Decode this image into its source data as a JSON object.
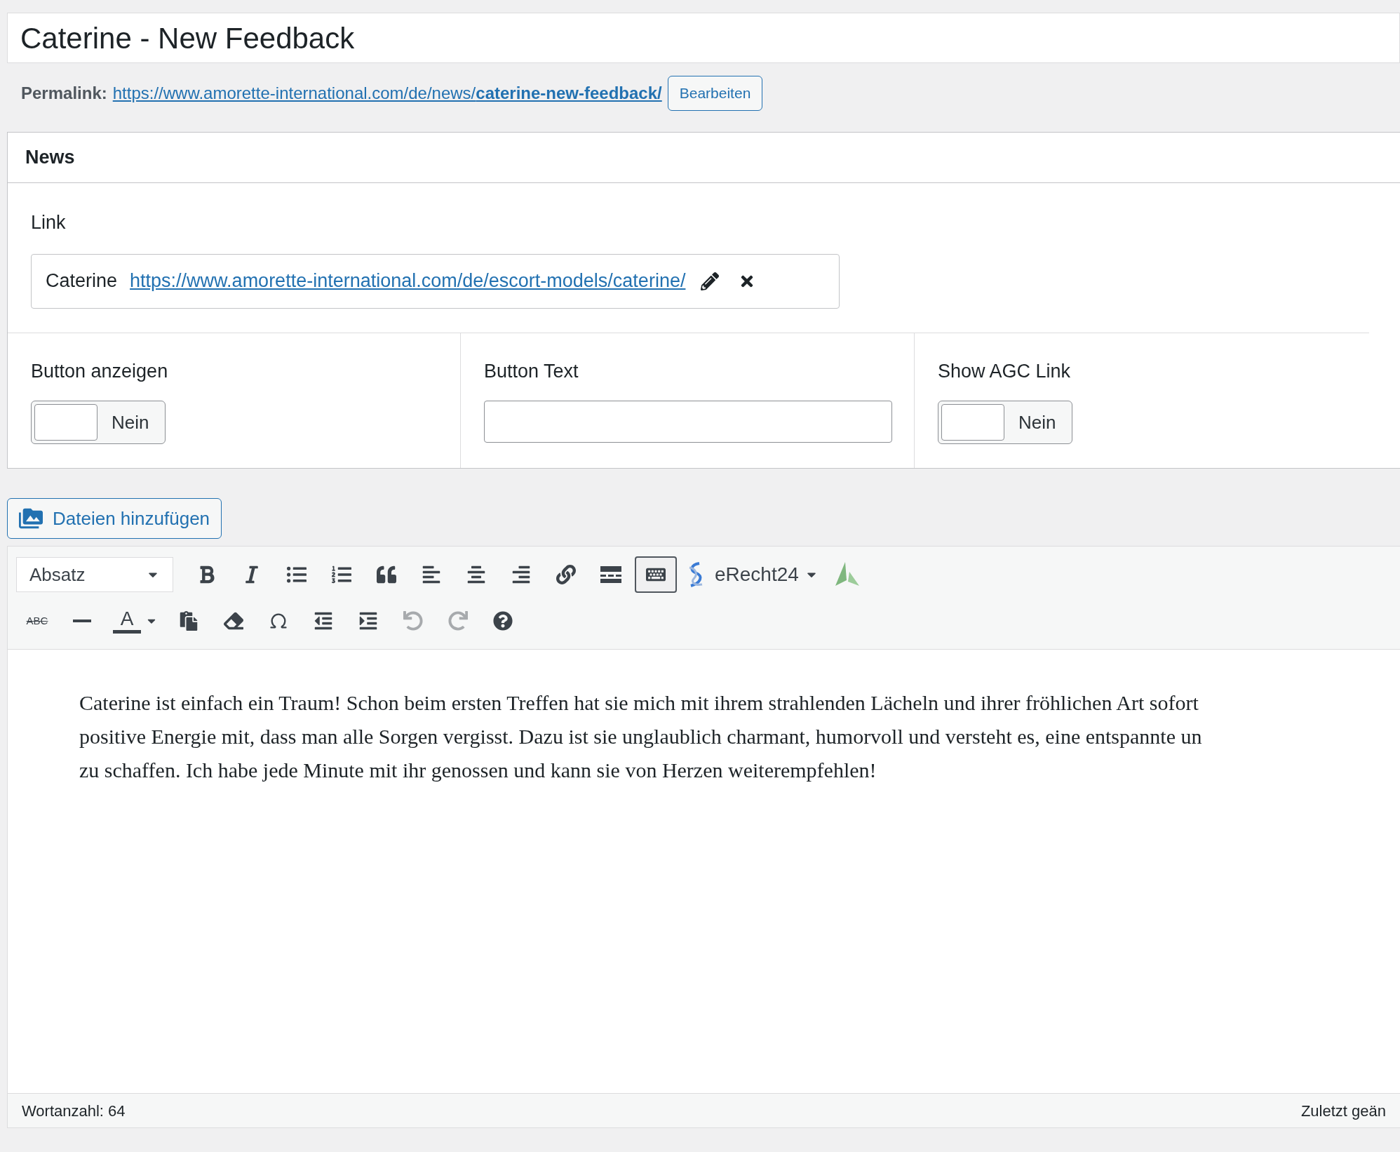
{
  "title": {
    "value": "Caterine - New Feedback"
  },
  "permalink": {
    "label": "Permalink:",
    "url": "https://www.amorette-international.com/de/news/**caterine-new-feedback/**",
    "button": "Bearbeiten"
  },
  "news_box": {
    "title": "News",
    "link_label": "Link",
    "link": {
      "text": "Caterine",
      "url": "https://www.amorette-international.com/de/escort-models/caterine/"
    },
    "fields": [
      {
        "kind": "toggle",
        "label": "Button anzeigen",
        "on": false,
        "state_text": "Nein"
      },
      {
        "kind": "text",
        "label": "Button Text"
      },
      {
        "kind": "toggle",
        "label": "Show AGC Link",
        "on": false,
        "state_text": "Nein"
      }
    ]
  },
  "media_button": "Dateien hinzufügen",
  "toolbar": {
    "rows": [
      [
        {
          "kind": "format",
          "label": "Absatz"
        },
        {
          "kind": "bold"
        },
        {
          "kind": "italic"
        },
        {
          "kind": "bullets"
        },
        {
          "kind": "numbers"
        },
        {
          "kind": "quote"
        },
        {
          "kind": "alignleft"
        },
        {
          "kind": "aligncenter"
        },
        {
          "kind": "alignright"
        },
        {
          "kind": "link"
        },
        {
          "kind": "more"
        },
        {
          "kind": "sink",
          "pressed": true
        },
        {
          "kind": "erecht",
          "label": "eRecht24"
        },
        {
          "kind": "leaf"
        }
      ],
      [
        {
          "kind": "strike",
          "label": "ABC"
        },
        {
          "kind": "hr"
        },
        {
          "kind": "color",
          "label": "A"
        },
        {
          "kind": "paste"
        },
        {
          "kind": "eraser"
        },
        {
          "kind": "omega"
        },
        {
          "kind": "outdent"
        },
        {
          "kind": "indent"
        },
        {
          "kind": "undo",
          "disabled": true
        },
        {
          "kind": "redo",
          "disabled": true
        },
        {
          "kind": "help"
        }
      ]
    ]
  },
  "content": {
    "lines": [
      "Caterine ist einfach ein Traum! Schon beim ersten Treffen hat sie mich mit ihrem strahlenden Lächeln und ihrer fröhlichen Art sofort",
      "positive Energie mit, dass man alle Sorgen vergisst. Dazu ist sie unglaublich charmant, humorvoll und versteht es, eine entspannte un",
      "zu schaffen. Ich habe jede Minute mit ihr genossen und kann sie von Herzen weiterempfehlen!"
    ]
  },
  "status_bar": {
    "word_count": "Wortanzahl: 64",
    "last_edit": "Zuletzt geän"
  }
}
